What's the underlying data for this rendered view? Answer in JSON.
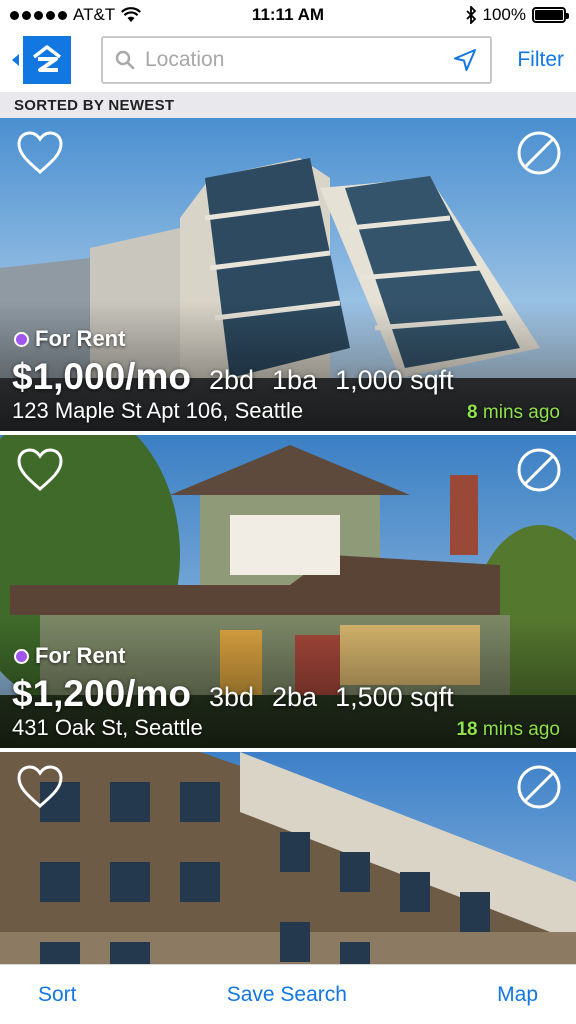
{
  "status_bar": {
    "carrier": "AT&T",
    "time": "11:11 AM",
    "battery": "100%"
  },
  "header": {
    "search_placeholder": "Location",
    "filter_label": "Filter"
  },
  "sort_banner": "SORTED BY NEWEST",
  "listings": [
    {
      "status": "For Rent",
      "price": "$1,000/mo",
      "beds": "2bd",
      "baths": "1ba",
      "sqft": "1,000 sqft",
      "address": "123 Maple St Apt 106, Seattle",
      "time_num": "8",
      "time_unit": "mins ago"
    },
    {
      "status": "For Rent",
      "price": "$1,200/mo",
      "beds": "3bd",
      "baths": "2ba",
      "sqft": "1,500 sqft",
      "address": "431 Oak St, Seattle",
      "time_num": "18",
      "time_unit": "mins ago"
    },
    {
      "status": "",
      "price": "",
      "beds": "",
      "baths": "",
      "sqft": "",
      "address": "",
      "time_num": "",
      "time_unit": ""
    }
  ],
  "toolbar": {
    "sort_label": "Sort",
    "save_search_label": "Save Search",
    "map_label": "Map"
  },
  "colors": {
    "accent": "#1277e1",
    "for_rent_dot": "#a155ef",
    "time_green": "#8fe04a"
  },
  "icons": [
    "wifi-icon",
    "bluetooth-icon",
    "battery-icon",
    "zillow-logo",
    "search-icon",
    "location-arrow-icon",
    "heart-icon",
    "hide-icon"
  ]
}
